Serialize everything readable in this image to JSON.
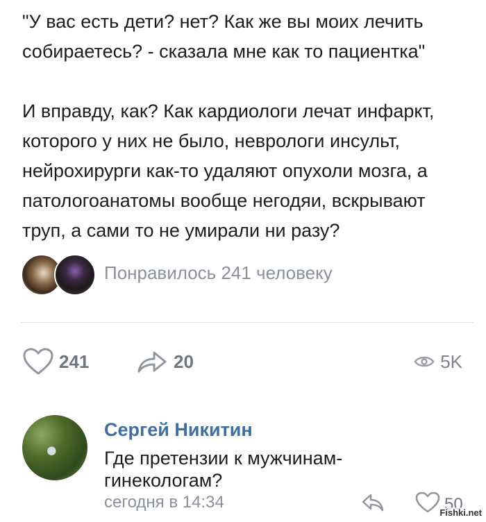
{
  "post": {
    "paragraph1": "\"У вас есть дети? нет? Как же вы моих лечить собираетесь? - сказала мне как то пациентка\"",
    "paragraph2": "И вправду, как? Как кардиологи лечат инфаркт, которого у них не было, неврологи инсульт, нейрохирурги как-то удаляют опухоли мозга, а патологоанатомы вообще негодяи, вскрывают труп, а сами то не умирали ни разу?"
  },
  "likers": {
    "text": "Понравилось 241 человеку"
  },
  "actions": {
    "likes": "241",
    "shares": "20",
    "views": "5K"
  },
  "comment": {
    "author": "Сергей Никитин",
    "text": "Где претензии к мужчинам-гинекологам?",
    "time": "сегодня в 14:34",
    "likes": "50"
  },
  "watermark": "Fishki.net",
  "icons": [
    "heart-icon",
    "share-icon",
    "eye-icon",
    "reply-icon"
  ],
  "colors": {
    "author": "#3d6fa6",
    "muted": "#8a9099",
    "icon": "#8f969e"
  }
}
